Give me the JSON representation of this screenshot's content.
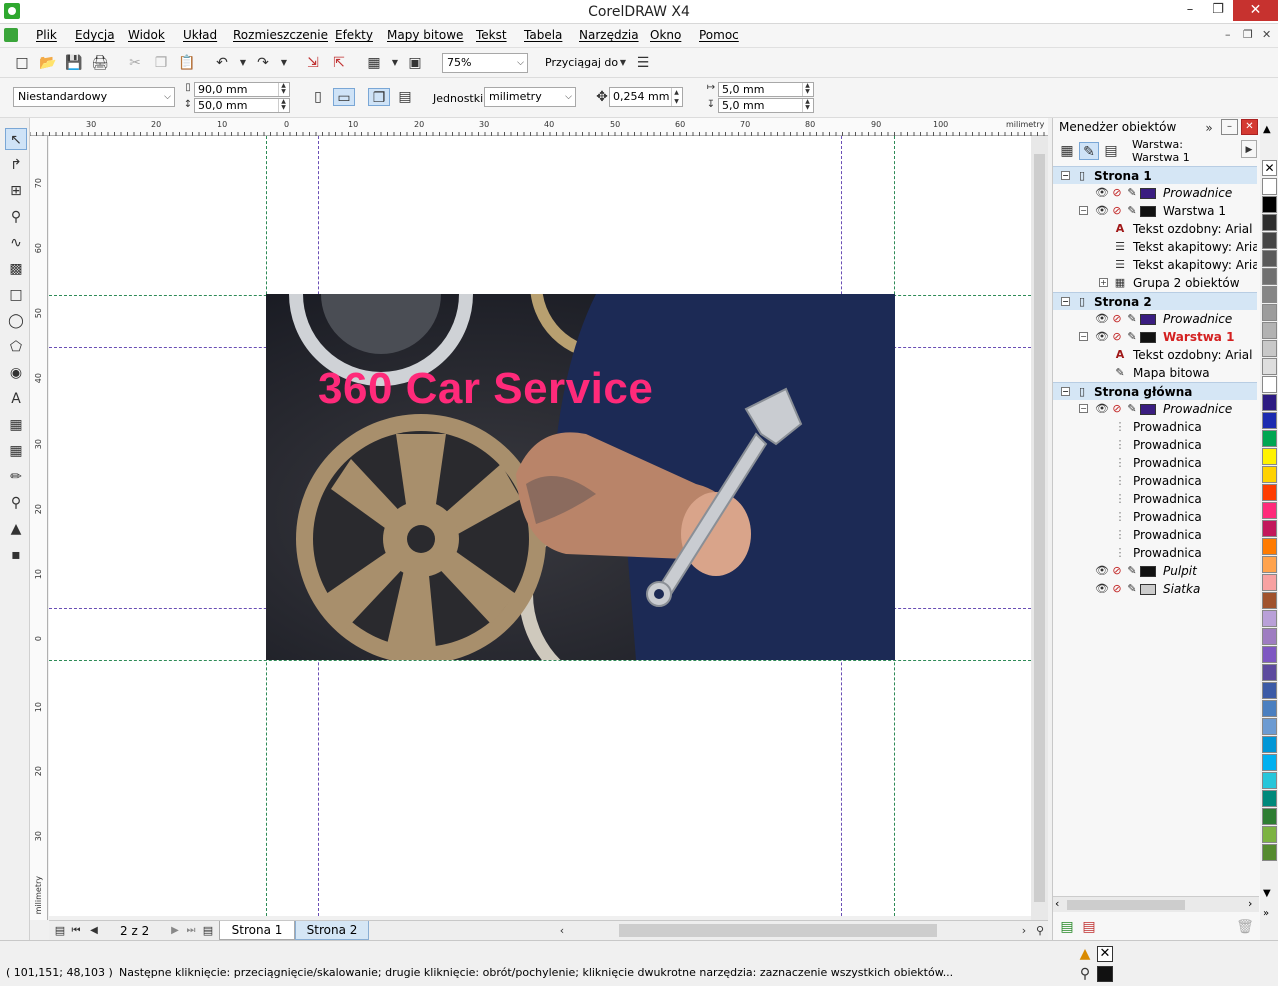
{
  "window": {
    "title": "CorelDRAW X4"
  },
  "menu": [
    "Plik",
    "Edycja",
    "Widok",
    "Układ",
    "Rozmieszczenie",
    "Efekty",
    "Mapy bitowe",
    "Tekst",
    "Tabela",
    "Narzędzia",
    "Okno",
    "Pomoc"
  ],
  "standard_bar": {
    "zoom": "75%",
    "snap_label": "Przyciągaj do"
  },
  "property_bar": {
    "paper_type": "Niestandardowy",
    "width": "90,0 mm",
    "height": "50,0 mm",
    "units_label": "Jednostki:",
    "units": "milimetry",
    "nudge": "0,254 mm",
    "dup_x": "5,0 mm",
    "dup_y": "5,0 mm"
  },
  "ruler": {
    "top_labels": [
      "30",
      "20",
      "10",
      "0",
      "10",
      "20",
      "30",
      "40",
      "50",
      "60",
      "70",
      "80",
      "90",
      "100"
    ],
    "top_unit": "milimetry",
    "left_labels": [
      "70",
      "60",
      "50",
      "40",
      "30",
      "20",
      "10",
      "0",
      "10",
      "20",
      "30"
    ],
    "left_unit": "milimetry"
  },
  "artwork": {
    "title": "360 Car Service"
  },
  "pages": {
    "counter": "2 z 2",
    "tabs": [
      "Strona 1",
      "Strona 2"
    ],
    "active": "Strona 2"
  },
  "object_manager": {
    "title": "Menedżer obiektów",
    "layer_label": "Warstwa:",
    "layer_name": "Warstwa 1",
    "rows": [
      {
        "text": "Strona 1",
        "kind": "page"
      },
      {
        "text": "Prowadnice",
        "kind": "layer",
        "italic": true,
        "swatch": "#3a1d80"
      },
      {
        "text": "Warstwa 1",
        "kind": "layer",
        "swatch": "#111111"
      },
      {
        "text": "Tekst ozdobny: Arial (Po",
        "kind": "obj",
        "icon": "artistic-text"
      },
      {
        "text": "Tekst akapitowy: Arial (I",
        "kind": "obj",
        "icon": "paragraph-text"
      },
      {
        "text": "Tekst akapitowy: Arial (I",
        "kind": "obj",
        "icon": "paragraph-text"
      },
      {
        "text": "Grupa 2 obiektów",
        "kind": "obj",
        "icon": "group"
      },
      {
        "text": "Strona 2",
        "kind": "page"
      },
      {
        "text": "Prowadnice",
        "kind": "layer",
        "italic": true,
        "swatch": "#3a1d80"
      },
      {
        "text": "Warstwa 1",
        "kind": "layer",
        "active": true,
        "swatch": "#111111"
      },
      {
        "text": "Tekst ozdobny: Arial (Po",
        "kind": "obj",
        "icon": "artistic-text"
      },
      {
        "text": "Mapa bitowa",
        "kind": "obj",
        "icon": "bitmap"
      },
      {
        "text": "Strona główna",
        "kind": "page"
      },
      {
        "text": "Prowadnice",
        "kind": "layer",
        "italic": true,
        "swatch": "#3a1d80"
      },
      {
        "text": "Prowadnica",
        "kind": "guide"
      },
      {
        "text": "Prowadnica",
        "kind": "guide"
      },
      {
        "text": "Prowadnica",
        "kind": "guide"
      },
      {
        "text": "Prowadnica",
        "kind": "guide"
      },
      {
        "text": "Prowadnica",
        "kind": "guide"
      },
      {
        "text": "Prowadnica",
        "kind": "guide"
      },
      {
        "text": "Prowadnica",
        "kind": "guide"
      },
      {
        "text": "Prowadnica",
        "kind": "guide"
      },
      {
        "text": "Pulpit",
        "kind": "layer",
        "italic": true,
        "swatch": "#111111"
      },
      {
        "text": "Siatka",
        "kind": "layer",
        "italic": true,
        "swatch": "#cccccc"
      }
    ]
  },
  "palette": [
    "#ffffff",
    "#000000",
    "#2e2e2e",
    "#444444",
    "#5a5a5a",
    "#707070",
    "#868686",
    "#9c9c9c",
    "#b2b2b2",
    "#c8c8c8",
    "#dedede",
    "#ffffff",
    "#2c1a82",
    "#1b2bb0",
    "#00a651",
    "#fff200",
    "#ffd200",
    "#ff3c00",
    "#ff2a7a",
    "#c2185b",
    "#ff7b00",
    "#ffa34d",
    "#f7a1a1",
    "#a0522d",
    "#b9a0d8",
    "#9e7cc1",
    "#7e57c2",
    "#5d4a9e",
    "#3b5aa6",
    "#4a7fc0",
    "#6c9bd2",
    "#0096d6",
    "#00b0f0",
    "#26c6da",
    "#00897b",
    "#2e7d32",
    "#7cb342",
    "#558b2f"
  ],
  "status": {
    "coords": "( 101,151; 48,103 )",
    "message": "Następne kliknięcie: przeciągnięcie/skalowanie; drugie kliknięcie: obrót/pochylenie; kliknięcie dwukrotne narzędzia: zaznaczenie wszystkich obiektów..."
  }
}
